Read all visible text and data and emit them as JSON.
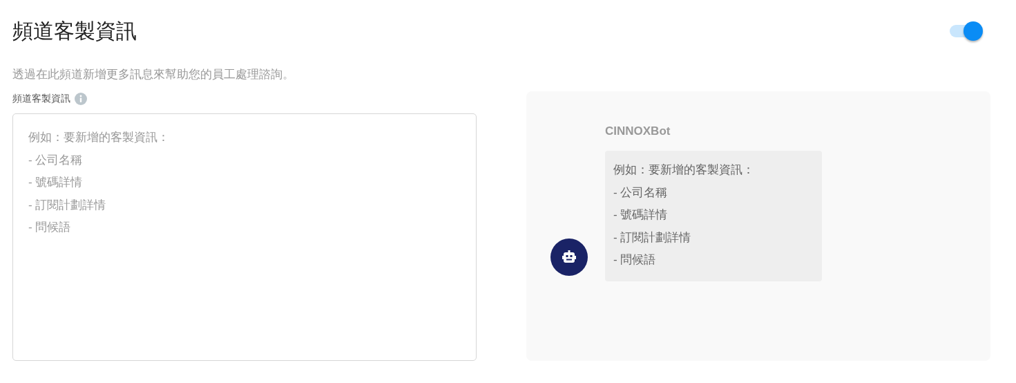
{
  "header": {
    "title": "頻道客製資訊",
    "toggle_on": true
  },
  "description": "透過在此頻道新增更多訊息來幫助您的員工處理諮詢。",
  "field": {
    "label": "頻道客製資訊",
    "placeholder": "例如：要新增的客製資訊：\n- 公司名稱\n- 號碼詳情\n- 訂閱計劃詳情\n- 問候語"
  },
  "preview": {
    "sender": "CINNOXBot",
    "message": "例如：要新增的客製資訊：\n- 公司名稱\n- 號碼詳情\n- 訂閱計劃詳情\n- 問候語"
  }
}
